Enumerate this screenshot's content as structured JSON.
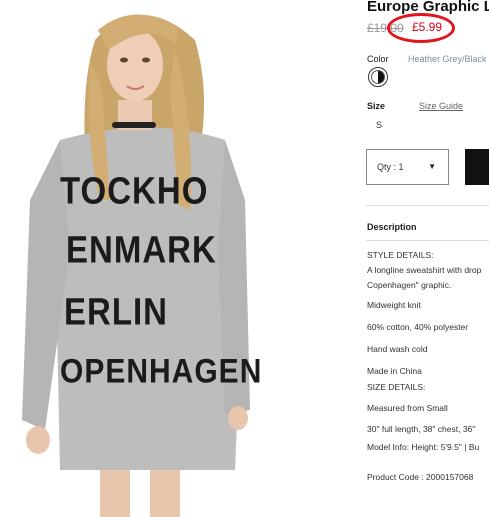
{
  "product": {
    "title": "Europe Graphic L",
    "price_old": "£19.00",
    "price_new": "£5.99",
    "color_label": "Color",
    "color_value": "Heather Grey/Black",
    "size_label": "Size",
    "size_guide": "Size Guide",
    "size_option": "S",
    "qty_label": "Qty : 1",
    "description_heading": "Description",
    "description_lines": [
      "STYLE DETAILS:",
      "A longline sweatshirt with drop",
      "Copenhagen\" graphic.",
      "Midweight knit",
      "60% cotton, 40% polyester",
      "Hand wash cold",
      "Made in China",
      "SIZE DETAILS:",
      "Measured from Small",
      "30\" full length, 38\" chest, 36\"",
      "Model Info: Height: 5'9.5\" | Bu",
      "Product Code : 2000157068"
    ]
  },
  "print_lines": [
    "TOCKHO",
    "ENMARK",
    "ERLIN",
    "OPENHAGEN"
  ],
  "colors": {
    "sale_red": "#d0021b",
    "annotation_red": "#e3131b",
    "sweater_grey": "#bdbdbd"
  }
}
